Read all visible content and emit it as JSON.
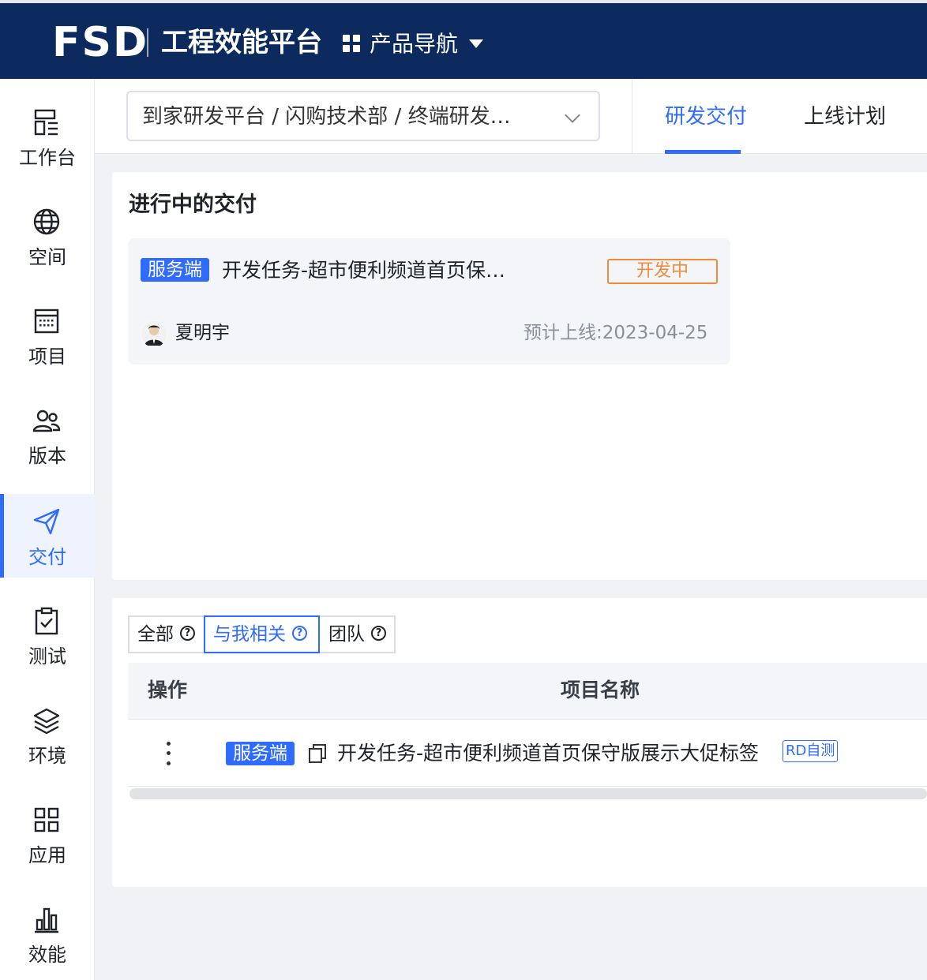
{
  "app": {
    "logo_text": "FSD",
    "platform_title": "工程效能平台",
    "product_nav_label": "产品导航"
  },
  "sidebar": {
    "items": [
      {
        "label": "工作台",
        "icon": "dashboard-icon"
      },
      {
        "label": "空间",
        "icon": "globe-icon"
      },
      {
        "label": "项目",
        "icon": "calendar-icon"
      },
      {
        "label": "版本",
        "icon": "users-icon"
      },
      {
        "label": "交付",
        "icon": "send-icon",
        "active": true
      },
      {
        "label": "测试",
        "icon": "clipboard-check-icon"
      },
      {
        "label": "环境",
        "icon": "layers-icon"
      },
      {
        "label": "应用",
        "icon": "apps-icon"
      },
      {
        "label": "效能",
        "icon": "bar-chart-icon"
      }
    ]
  },
  "header": {
    "breadcrumb": "到家研发平台 / 闪购技术部 / 终端研发…",
    "tabs": [
      {
        "label": "研发交付",
        "active": true
      },
      {
        "label": "上线计划",
        "active": false
      }
    ]
  },
  "in_progress": {
    "title": "进行中的交付",
    "card": {
      "tag": "服务端",
      "title": "开发任务-超市便利频道首页保…",
      "status": "开发中",
      "owner": "夏明宇",
      "eta_label": "预计上线:",
      "eta_date": "2023-04-25"
    }
  },
  "filters": {
    "options": [
      {
        "label": "全部",
        "active": false
      },
      {
        "label": "与我相关",
        "active": true
      },
      {
        "label": "团队",
        "active": false
      }
    ],
    "help_glyph": "?"
  },
  "table": {
    "columns": [
      "操作",
      "项目名称"
    ],
    "rows": [
      {
        "tag": "服务端",
        "name": "开发任务-超市便利频道首页保守版展示大促标签",
        "badge": "RD自测"
      }
    ]
  },
  "colors": {
    "topbar": "#0d2a5e",
    "accent": "#2f6bff",
    "status_orange": "#f08b3e"
  }
}
